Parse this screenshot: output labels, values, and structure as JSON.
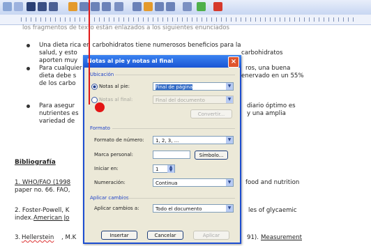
{
  "document": {
    "line0": "los fragmentos de texto están enlazados a los siguientes enunciados",
    "bullets": [
      [
        "Una dieta rica en carbohidratos tiene numerosos beneficios para la",
        "salud, y esto",
        "carbohidratos",
        "aporten muy"
      ],
      [
        "Para cualquier",
        "ros, una buena",
        "dieta debe s",
        "enervado en un 55%",
        "de los carbo"
      ],
      [
        "Para asegur",
        "diario óptimo es",
        "nutrientes es",
        "y una amplia",
        "variedad de"
      ]
    ],
    "heading": "Bibliografía",
    "refs": [
      {
        "start": "1. WHO/FAO (1998",
        "end": "food and nutrition",
        "line2": "paper no. 66. FAO,"
      },
      {
        "start": "2. Foster-Powell, K",
        "end": "les of glycaemic",
        "line2a": "index.",
        "line2b": "American Jo"
      },
      {
        "start": "3.",
        "name": "Hellerstein",
        "mid": ", M.K",
        "end": "91).",
        "end2": "Measurement"
      }
    ]
  },
  "dialog": {
    "title": "Notas al pie y notas al final",
    "close": "×",
    "section_location": "Ubicación",
    "footnotes_label": "Notas al pie:",
    "footnotes_value": "Final de página",
    "endnotes_label": "Notas al final:",
    "endnotes_value": "Final del documento",
    "convert_button": "Convertir...",
    "section_format": "Formato",
    "number_format_label": "Formato de número:",
    "number_format_value": "1, 2, 3, ...",
    "custom_mark_label": "Marca personal:",
    "symbol_button": "Símbolo...",
    "start_at_label": "Iniciar en:",
    "start_at_value": "1",
    "numbering_label": "Numeración:",
    "numbering_value": "Continua",
    "section_apply": "Aplicar cambios",
    "apply_to_label": "Aplicar cambios a:",
    "apply_to_value": "Todo el documento",
    "insert_button": "Insertar",
    "cancel_button": "Cancelar",
    "apply_button": "Aplicar"
  }
}
